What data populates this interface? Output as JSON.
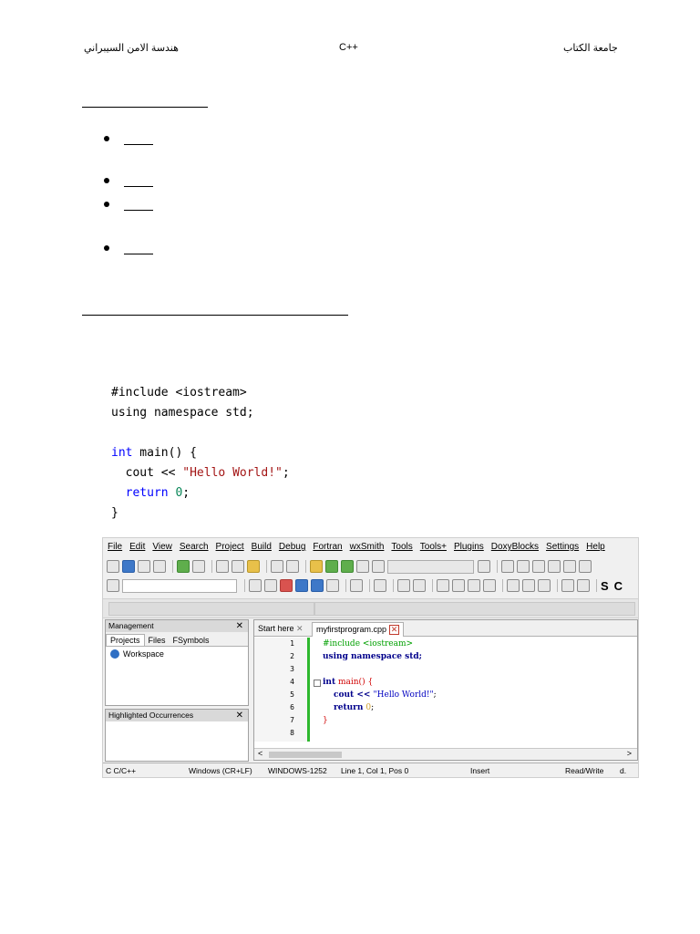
{
  "header": {
    "left": "هندسة الامن السيبراني",
    "center": "C++",
    "right": "جامعة الكتاب"
  },
  "code_sample": {
    "lines": [
      "#include <iostream>",
      "using namespace std;",
      "",
      "int main() {",
      "  cout << \"Hello World!\";",
      "  return 0;",
      "}"
    ],
    "tokens": {
      "int": "int",
      "main_rest": " main() {",
      "cout_pre": "  cout << ",
      "hello": "\"Hello World!\"",
      "semi": ";",
      "return_indent": "  ",
      "return_kw": "return",
      "zero": "0",
      "close": "}"
    }
  },
  "ide": {
    "menu": [
      "File",
      "Edit",
      "View",
      "Search",
      "Project",
      "Build",
      "Debug",
      "Fortran",
      "wxSmith",
      "Tools",
      "Tools+",
      "Plugins",
      "DoxyBlocks",
      "Settings",
      "Help"
    ],
    "toolbar_glyphs": {
      "s": "S",
      "c": "C"
    },
    "management": {
      "title": "Management",
      "close": "✕",
      "tabs": [
        "Projects",
        "Files",
        "FSymbols"
      ],
      "workspace": "Workspace"
    },
    "highlighted": {
      "title": "Highlighted Occurrences",
      "close": "✕"
    },
    "editor": {
      "tab1": "Start here",
      "tab1_close": "✕",
      "tab2": "myfirstprogram.cpp",
      "tab2_close": "✕",
      "line_numbers": [
        "1",
        "2",
        "3",
        "4",
        "5",
        "6",
        "7",
        "8"
      ],
      "code": {
        "l1": "#include <iostream>",
        "l2": "using namespace std;",
        "l4_kw": "int",
        "l4_rest": " main() {",
        "l5_pre": "cout << ",
        "l5_str": "\"Hello World!\"",
        "l5_end": ";",
        "l6_kw": "return",
        "l6_num": " 0",
        "l6_end": ";",
        "l7": "}"
      },
      "scroll_left": "<",
      "scroll_right": ">"
    },
    "status": {
      "lang": "C C/C++",
      "eol": "Windows (CR+LF)",
      "encoding": "WINDOWS-1252",
      "position": "Line 1, Col 1, Pos 0",
      "mode": "Insert",
      "rw": "Read/Write",
      "extra": "d."
    }
  }
}
